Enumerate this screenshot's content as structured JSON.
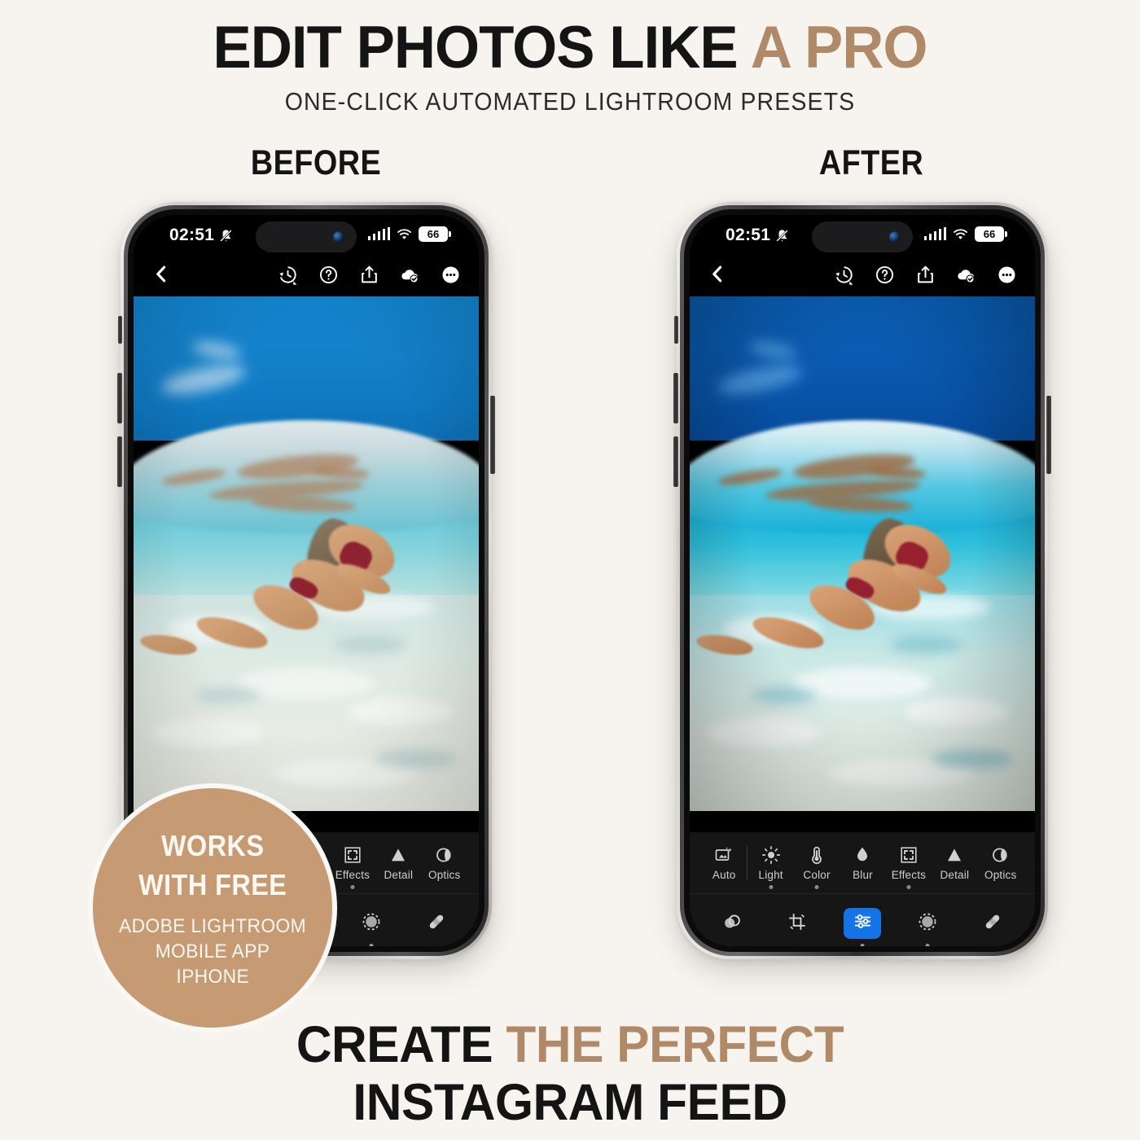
{
  "colors": {
    "background": "#f7f4ef",
    "accent_tan": "#b08a68",
    "badge_fill": "#c69a73",
    "text_dark": "#141414",
    "lightroom_blue": "#1473e6"
  },
  "header": {
    "headline_part1": "EDIT PHOTOS LIKE ",
    "headline_accent": "A PRO",
    "subhead": "ONE-CLICK AUTOMATED LIGHTROOM PRESETS"
  },
  "compare_labels": {
    "before": "BEFORE",
    "after": "AFTER"
  },
  "footer": {
    "line1_part1": "CREATE ",
    "line1_accent": "THE PERFECT",
    "line2": "INSTAGRAM FEED"
  },
  "badge": {
    "line1": "WORKS",
    "line2": "WITH FREE",
    "sub1": "ADOBE LIGHTROOM",
    "sub2": "MOBILE APP",
    "sub3": "IPHONE"
  },
  "phone": {
    "status_bar": {
      "time": "02:51",
      "mute_icon": "bell-slash-icon",
      "signal_icon": "cellular-signal-icon",
      "wifi_icon": "wifi-icon",
      "battery_level": "66"
    },
    "app_toolbar": {
      "back_icon": "chevron-left-icon",
      "actions": [
        {
          "icon": "history-clock-icon",
          "name": "version-history"
        },
        {
          "icon": "question-circle-icon",
          "name": "help"
        },
        {
          "icon": "share-icon",
          "name": "share"
        },
        {
          "icon": "cloud-check-icon",
          "name": "cloud-synced"
        },
        {
          "icon": "ellipsis-circle-icon",
          "name": "more-options"
        }
      ]
    },
    "edit_tabs": [
      {
        "label": "Auto",
        "icon": "auto-enhance-icon",
        "dot": false
      },
      {
        "label": "Light",
        "icon": "sun-icon",
        "dot": true
      },
      {
        "label": "Color",
        "icon": "thermometer-icon",
        "dot": true
      },
      {
        "label": "Blur",
        "icon": "droplet-icon",
        "dot": false
      },
      {
        "label": "Effects",
        "icon": "frame-corners-icon",
        "dot": true
      },
      {
        "label": "Detail",
        "icon": "triangle-icon",
        "dot": false
      },
      {
        "label": "Optics",
        "icon": "lens-circle-icon",
        "dot": false
      }
    ],
    "mode_tools": [
      {
        "name": "presets-tool",
        "icon": "overlapping-circles-icon",
        "active": false,
        "dot": false
      },
      {
        "name": "crop-tool",
        "icon": "crop-rotate-icon",
        "active": false,
        "dot": false
      },
      {
        "name": "edit-tool",
        "icon": "sliders-icon",
        "active": true,
        "dot": true
      },
      {
        "name": "masking-tool",
        "icon": "dashed-circle-icon",
        "active": false,
        "dot": true
      },
      {
        "name": "healing-tool",
        "icon": "bandage-icon",
        "active": false,
        "dot": false
      }
    ],
    "home_indicator": "home-indicator"
  },
  "photo": {
    "subject": "woman snorkelling underwater over white sand",
    "before_note": "unedited, flat colors",
    "after_note": "preset applied, deep blue sky and vivid turquoise water"
  }
}
